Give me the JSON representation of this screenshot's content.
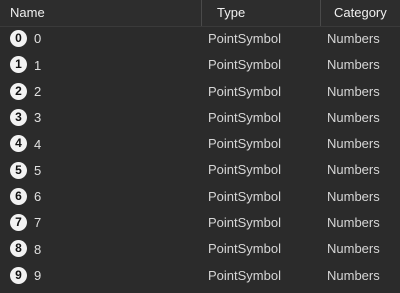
{
  "columns": {
    "name": "Name",
    "type": "Type",
    "category": "Category"
  },
  "rows": [
    {
      "symbol": "0",
      "name": "0",
      "type": "PointSymbol",
      "category": "Numbers"
    },
    {
      "symbol": "1",
      "name": "1",
      "type": "PointSymbol",
      "category": "Numbers"
    },
    {
      "symbol": "2",
      "name": "2",
      "type": "PointSymbol",
      "category": "Numbers"
    },
    {
      "symbol": "3",
      "name": "3",
      "type": "PointSymbol",
      "category": "Numbers"
    },
    {
      "symbol": "4",
      "name": "4",
      "type": "PointSymbol",
      "category": "Numbers"
    },
    {
      "symbol": "5",
      "name": "5",
      "type": "PointSymbol",
      "category": "Numbers"
    },
    {
      "symbol": "6",
      "name": "6",
      "type": "PointSymbol",
      "category": "Numbers"
    },
    {
      "symbol": "7",
      "name": "7",
      "type": "PointSymbol",
      "category": "Numbers"
    },
    {
      "symbol": "8",
      "name": "8",
      "type": "PointSymbol",
      "category": "Numbers"
    },
    {
      "symbol": "9",
      "name": "9",
      "type": "PointSymbol",
      "category": "Numbers"
    }
  ]
}
